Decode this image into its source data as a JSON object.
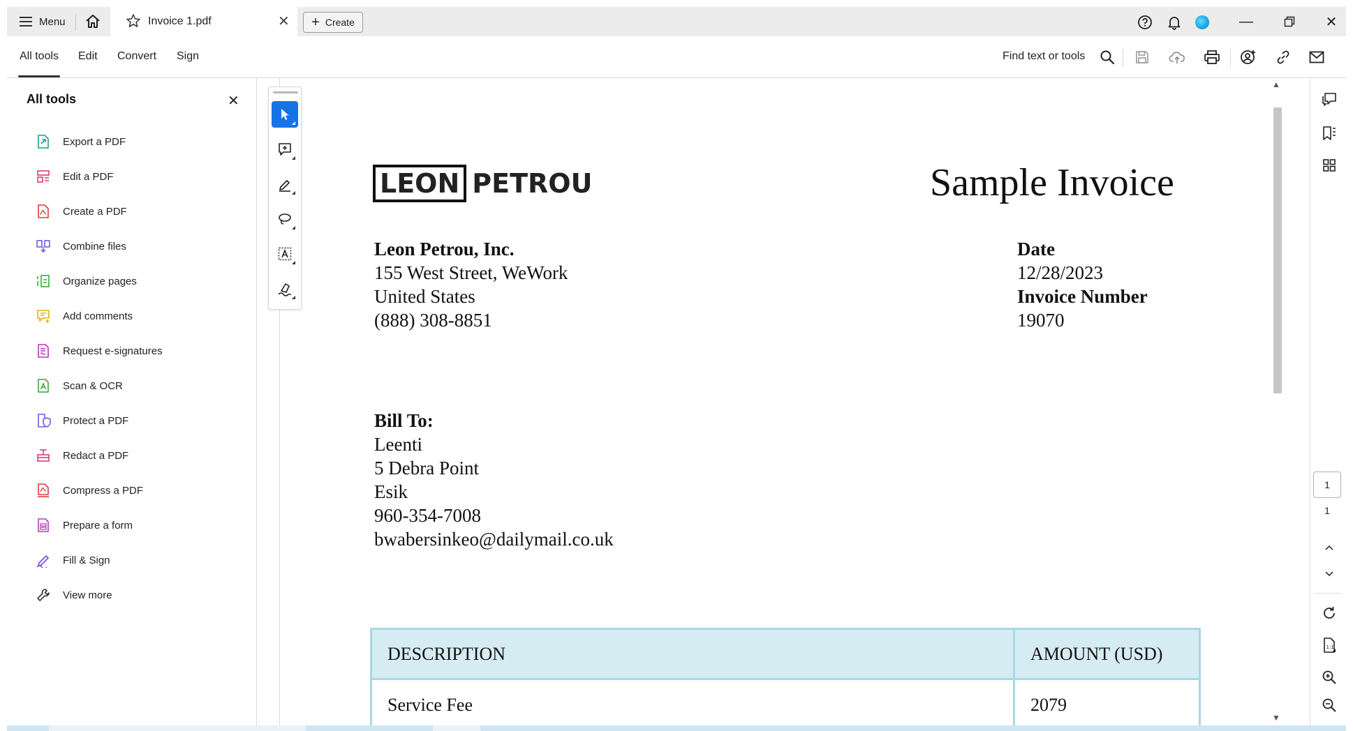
{
  "titlebar": {
    "menu_label": "Menu",
    "tab_title": "Invoice 1.pdf",
    "create_label": "Create"
  },
  "toolbar": {
    "tabs": [
      {
        "label": "All tools"
      },
      {
        "label": "Edit"
      },
      {
        "label": "Convert"
      },
      {
        "label": "Sign"
      }
    ],
    "find_label": "Find text or tools"
  },
  "left_panel": {
    "title": "All tools",
    "items": [
      {
        "label": "Export a PDF",
        "icon": "export-pdf-icon",
        "color": "#1a9e87"
      },
      {
        "label": "Edit a PDF",
        "icon": "edit-pdf-icon",
        "color": "#e0397a"
      },
      {
        "label": "Create a PDF",
        "icon": "create-pdf-icon",
        "color": "#e0393e"
      },
      {
        "label": "Combine files",
        "icon": "combine-files-icon",
        "color": "#6b5fe0"
      },
      {
        "label": "Organize pages",
        "icon": "organize-pages-icon",
        "color": "#3ca83c"
      },
      {
        "label": "Add comments",
        "icon": "add-comments-icon",
        "color": "#e0b400"
      },
      {
        "label": "Request e-signatures",
        "icon": "request-esign-icon",
        "color": "#b43ab4"
      },
      {
        "label": "Scan & OCR",
        "icon": "scan-ocr-icon",
        "color": "#3ca83c"
      },
      {
        "label": "Protect a PDF",
        "icon": "protect-pdf-icon",
        "color": "#6b5fe0"
      },
      {
        "label": "Redact a PDF",
        "icon": "redact-pdf-icon",
        "color": "#e0397a"
      },
      {
        "label": "Compress a PDF",
        "icon": "compress-pdf-icon",
        "color": "#e0393e"
      },
      {
        "label": "Prepare a form",
        "icon": "prepare-form-icon",
        "color": "#b43ab4"
      },
      {
        "label": "Fill & Sign",
        "icon": "fill-sign-icon",
        "color": "#7a4ae0"
      },
      {
        "label": "View more",
        "icon": "view-more-icon",
        "color": "#333333"
      }
    ]
  },
  "invoice": {
    "logo_boxed": "LEON",
    "logo_rest": "PETROU",
    "title": "Sample Invoice",
    "company_name": "Leon Petrou, Inc.",
    "company_address1": "155 West Street, WeWork",
    "company_address2": "United States",
    "company_phone": "(888) 308-8851",
    "date_label": "Date",
    "date_value": "12/28/2023",
    "invoice_number_label": "Invoice Number",
    "invoice_number_value": "19070",
    "bill_to_label": "Bill To:",
    "bill_to_name": "Leenti",
    "bill_to_address": "5 Debra Point",
    "bill_to_city": "Esik",
    "bill_to_phone": "960-354-7008",
    "bill_to_email": "bwabersinkeo@dailymail.co.uk",
    "table": {
      "headers": [
        "DESCRIPTION",
        "AMOUNT (USD)"
      ],
      "rows": [
        [
          "Service Fee",
          "2079"
        ]
      ]
    }
  },
  "page_nav": {
    "current_page": "1",
    "total_pages": "1"
  },
  "colors": {
    "accent": "#1473e6",
    "table_border": "#a8d8e6",
    "table_header_bg": "#d6ecf3"
  }
}
